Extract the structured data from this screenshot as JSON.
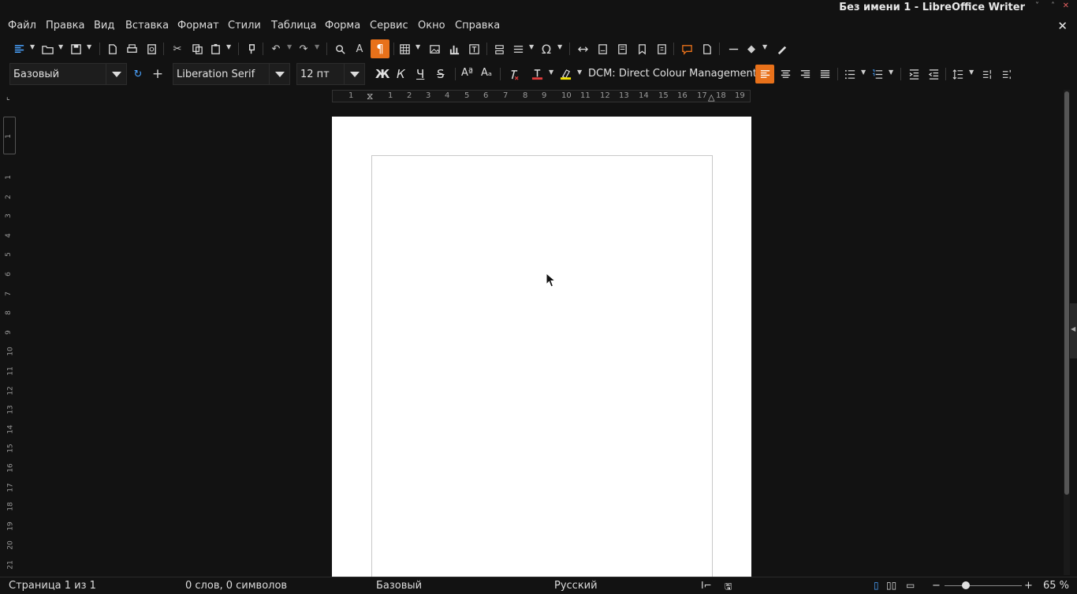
{
  "window": {
    "title": "Без имени 1 - LibreOffice Writer",
    "minimize": "˅",
    "maximize": "˄",
    "close": "✕",
    "doc_close": "✕"
  },
  "menu": [
    "Файл",
    "Правка",
    "Вид",
    "Вставка",
    "Формат",
    "Стили",
    "Таблица",
    "Форма",
    "Сервис",
    "Окно",
    "Справка"
  ],
  "formatting": {
    "paragraph_style": "Базовый",
    "font_name": "Liberation Serif",
    "font_size": "12 пт",
    "bold": "Ж",
    "italic": "К",
    "underline": "Ч",
    "strikethrough": "S",
    "superscript": "Aª",
    "subscript": "Aₐ",
    "special_char": "Ω",
    "dcm_label": "DCM: Direct Colour Management"
  },
  "ruler": {
    "h_labels": [
      "1",
      "1",
      "2",
      "3",
      "4",
      "5",
      "6",
      "7",
      "8",
      "9",
      "10",
      "11",
      "12",
      "13",
      "14",
      "15",
      "16",
      "17",
      "18",
      "19"
    ],
    "v_labels": [
      "1",
      "1",
      "2",
      "3",
      "4",
      "5",
      "6",
      "7",
      "8",
      "9",
      "10",
      "11",
      "12",
      "13",
      "14",
      "15",
      "16",
      "17",
      "18",
      "19",
      "20",
      "21"
    ]
  },
  "status": {
    "page": "Страница 1 из 1",
    "words": "0 слов, 0 символов",
    "style": "Базовый",
    "language": "Русский",
    "zoom": "65 %",
    "zoom_minus": "−",
    "zoom_plus": "+",
    "zoom_level": 0.28
  },
  "colors": {
    "accent": "#e8711a",
    "font_color": "#e03c3c",
    "highlight": "#f5e400",
    "background": "#121212"
  }
}
